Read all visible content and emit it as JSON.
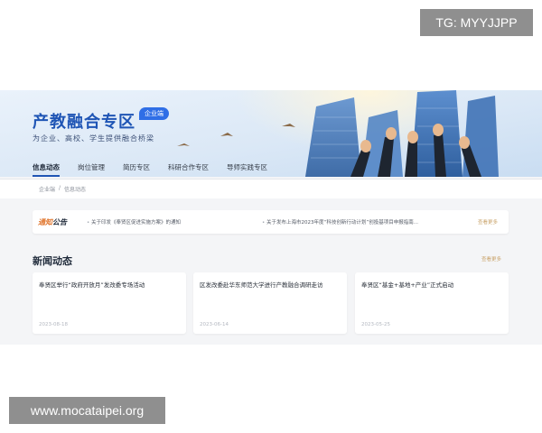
{
  "overlay": {
    "tg_text": "TG: MYYJJPP",
    "site_text": "www.mocataipei.org"
  },
  "banner": {
    "title": "产教融合专区",
    "tag": "企业端",
    "subtitle": "为企业、高校、学生提供融合桥梁"
  },
  "nav": {
    "items": [
      {
        "label": "信息动态",
        "active": true
      },
      {
        "label": "岗位管理",
        "active": false
      },
      {
        "label": "简历专区",
        "active": false
      },
      {
        "label": "科研合作专区",
        "active": false
      },
      {
        "label": "导师实践专区",
        "active": false
      }
    ]
  },
  "breadcrumb": {
    "home": "企业端",
    "sep": "/",
    "current": "信息动态"
  },
  "notice": {
    "logo_a": "通知",
    "logo_b": "公告",
    "items": [
      "关于印发《奉贤区促进实施方案》的通知",
      "关于发布上海市2023年度“科技创新行动计划”创投基项目申报指南..."
    ],
    "more": "查看更多"
  },
  "news": {
    "title": "新闻动态",
    "more": "查看更多",
    "cards": [
      {
        "title": "奉贤区举行“政府开放月”发改委专场活动",
        "date": "2023-08-18"
      },
      {
        "title": "区发改委赴华东师范大学进行产教融合调研走访",
        "date": "2023-06-14"
      },
      {
        "title": "奉贤区“基金+基地+产业”正式启动",
        "date": "2023-05-25"
      }
    ]
  },
  "colors": {
    "brand_blue": "#1f55b5",
    "notice_orange": "#e0762e",
    "more_gold": "#c9a36a"
  }
}
